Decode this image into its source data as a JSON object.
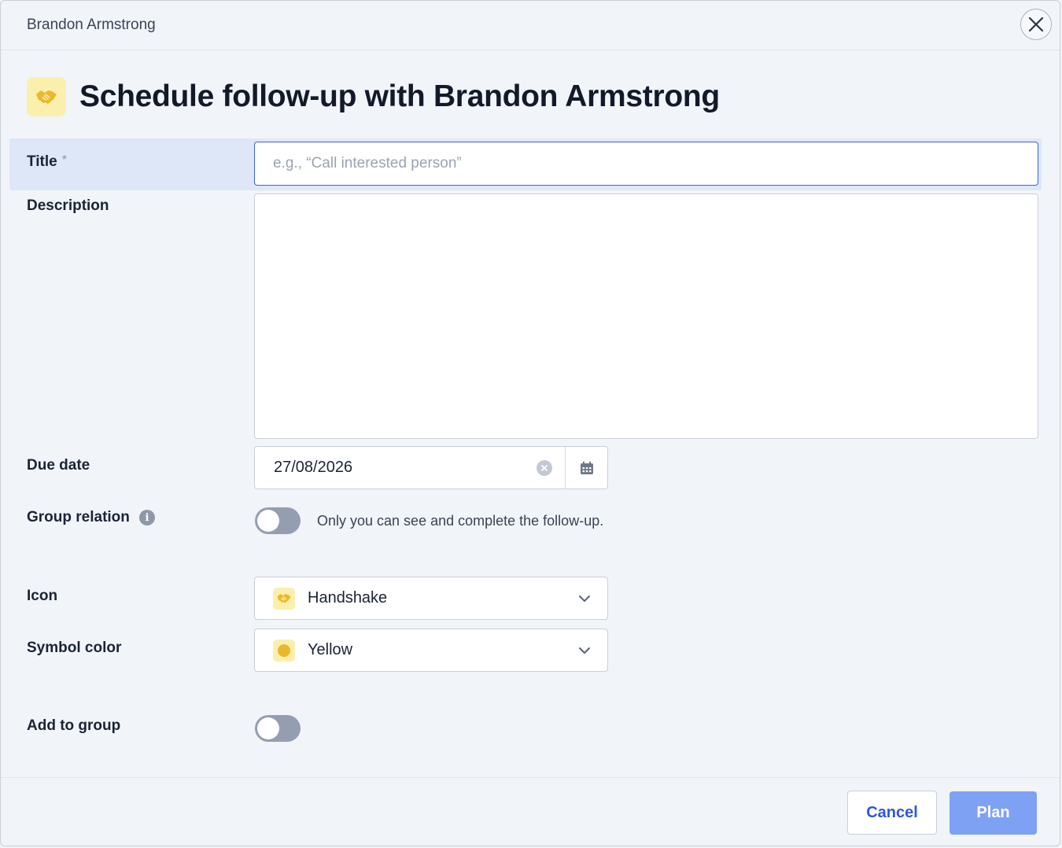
{
  "header": {
    "contact_name": "Brandon Armstrong",
    "close_icon": "close-icon"
  },
  "dialog": {
    "title": "Schedule follow-up with Brandon Armstrong",
    "title_icon": "handshake-icon"
  },
  "form": {
    "title": {
      "label": "Title",
      "required_mark": "*",
      "value": "",
      "placeholder": "e.g., “Call interested person”"
    },
    "description": {
      "label": "Description",
      "value": ""
    },
    "due_date": {
      "label": "Due date",
      "value": "27/08/2026"
    },
    "group_relation": {
      "label": "Group relation",
      "enabled": false,
      "hint": "Only you can see and complete the follow-up."
    },
    "icon": {
      "label": "Icon",
      "selected": "Handshake"
    },
    "symbol_color": {
      "label": "Symbol color",
      "selected": "Yellow",
      "swatch_color": "#e9b82b"
    },
    "add_to_group": {
      "label": "Add to group",
      "enabled": false
    }
  },
  "footer": {
    "cancel_label": "Cancel",
    "plan_label": "Plan"
  },
  "colors": {
    "accent": "#3b64d9",
    "primary_disabled": "#7fa1f4",
    "icon_yellow": "#e9b82b",
    "icon_bg": "#fbefae"
  }
}
